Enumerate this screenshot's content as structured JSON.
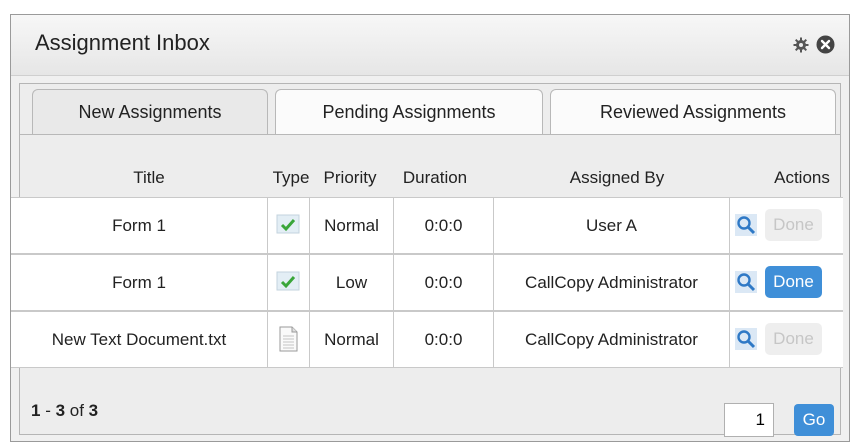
{
  "panel": {
    "title": "Assignment Inbox",
    "icons": [
      "gear-icon",
      "close-icon"
    ]
  },
  "tabs": [
    {
      "label": "New Assignments",
      "active": true
    },
    {
      "label": "Pending Assignments",
      "active": false
    },
    {
      "label": "Reviewed Assignments",
      "active": false
    }
  ],
  "columns": {
    "title": "Title",
    "type": "Type",
    "priority": "Priority",
    "duration": "Duration",
    "assigned_by": "Assigned By",
    "actions": "Actions"
  },
  "rows": [
    {
      "title": "Form 1",
      "type_icon": "form-check-icon",
      "priority": "Normal",
      "duration": "0:0:0",
      "assigned_by": "User A",
      "done_label": "Done",
      "done_enabled": false
    },
    {
      "title": "Form 1",
      "type_icon": "form-check-icon",
      "priority": "Low",
      "duration": "0:0:0",
      "assigned_by": "CallCopy Administrator",
      "done_label": "Done",
      "done_enabled": true
    },
    {
      "title": "New Text Document.txt",
      "type_icon": "text-document-icon",
      "priority": "Normal",
      "duration": "0:0:0",
      "assigned_by": "CallCopy Administrator",
      "done_label": "Done",
      "done_enabled": false
    }
  ],
  "footer": {
    "range_start": "1",
    "range_sep": " - ",
    "range_end": "3",
    "of_label": " of ",
    "total": "3",
    "page_value": "1",
    "go_label": "Go"
  },
  "colors": {
    "accent": "#3f8fd8",
    "check": "#4caf50",
    "disabled_text": "#c6c6c6"
  }
}
